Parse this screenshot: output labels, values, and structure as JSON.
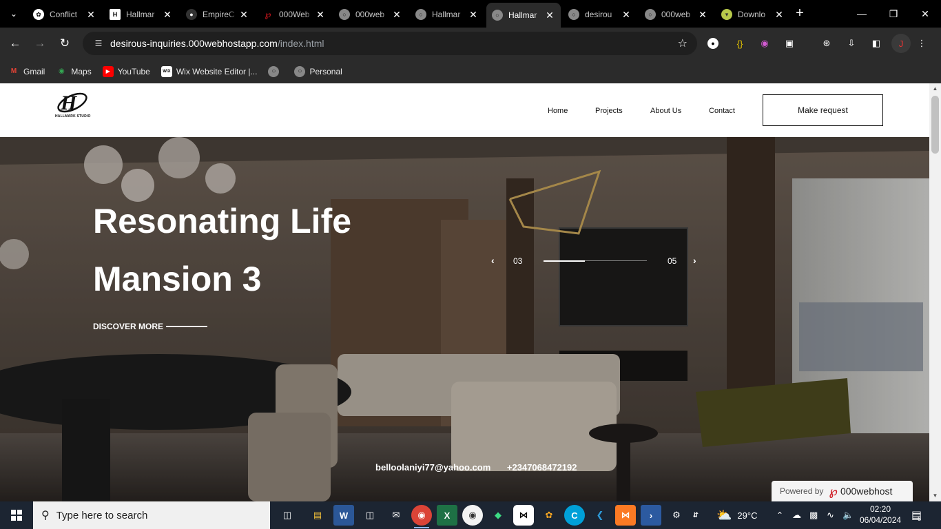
{
  "browser": {
    "tabs": [
      {
        "title": "Conflict",
        "favicon": "chatgpt-icon",
        "color": "#1a1a1a"
      },
      {
        "title": "Hallmar",
        "favicon": "hallmark-icon",
        "color": "#ffffff"
      },
      {
        "title": "EmpireC",
        "favicon": "github-icon",
        "color": "#222"
      },
      {
        "title": "000Web",
        "favicon": "000webhost-icon",
        "color": "#c0151b"
      },
      {
        "title": "000web",
        "favicon": "globe-icon",
        "color": "#777"
      },
      {
        "title": "Hallmar",
        "favicon": "globe-icon",
        "color": "#777"
      },
      {
        "title": "Hallmar",
        "favicon": "globe-icon",
        "color": "#777"
      },
      {
        "title": "desirou",
        "favicon": "globe-icon",
        "color": "#777"
      },
      {
        "title": "000web",
        "favicon": "globe-icon",
        "color": "#777"
      },
      {
        "title": "Downlo",
        "favicon": "download-icon",
        "color": "#7a8a2a"
      }
    ],
    "active_tab_index": 6,
    "url_host": "desirous-inquiries.000webhostapp.com",
    "url_path": "/index.html",
    "bookmarks": [
      {
        "label": "Gmail",
        "icon": "gmail-icon"
      },
      {
        "label": "Maps",
        "icon": "maps-icon"
      },
      {
        "label": "YouTube",
        "icon": "youtube-icon"
      },
      {
        "label": "Wix Website Editor |...",
        "icon": "wix-icon"
      },
      {
        "label": "",
        "icon": "globe-icon"
      },
      {
        "label": "Personal",
        "icon": "globe-icon"
      }
    ]
  },
  "site": {
    "logo_text": "HALLMARK STUDIO",
    "nav": [
      "Home",
      "Projects",
      "About Us",
      "Contact"
    ],
    "cta": "Make request",
    "hero": {
      "title_line1": "Resonating Life",
      "title_line2": "Mansion 3",
      "discover": "DISCOVER MORE",
      "slide_current": "03",
      "slide_total": "05",
      "slide_progress": 0.4
    },
    "email": "belloolaniyi77@yahoo.com",
    "phone": "+2347068472192",
    "powered_by": "Powered by",
    "powered_brand": "000webhost"
  },
  "taskbar": {
    "search_placeholder": "Type here to search",
    "weather": "29°C",
    "time": "02:20",
    "date": "06/04/2024",
    "notifications": "8"
  },
  "colors": {
    "accent": "#8ab4f8",
    "chrome_dark": "#2b2b2b",
    "hero_text": "#ffffff"
  }
}
